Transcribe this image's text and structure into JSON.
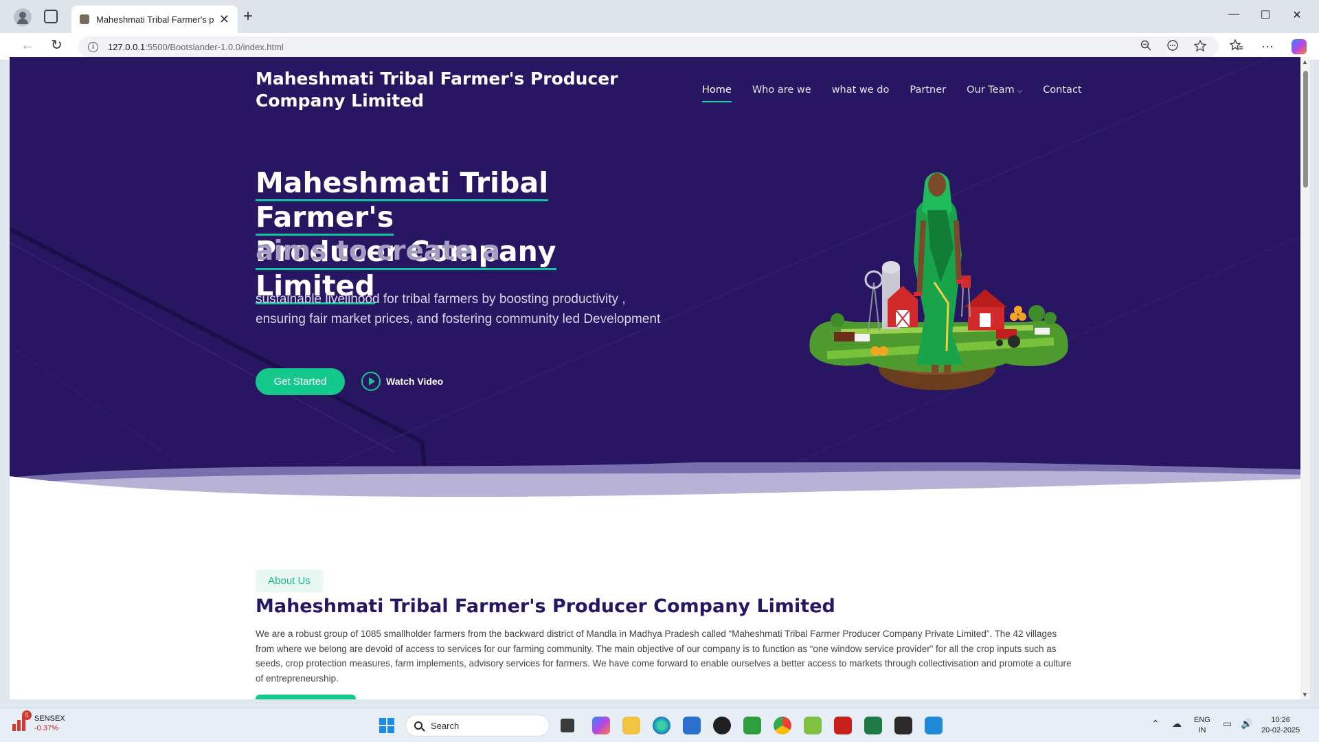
{
  "browser": {
    "tab_title": "Maheshmati Tribal Farmer's produ",
    "url_host": "127.0.0.1",
    "url_path": ":5500/Bootslander-1.0.0/index.html",
    "new_tab_symbol": "+",
    "tab_close_symbol": "✕",
    "minimize_symbol": "—",
    "maximize_symbol": "☐",
    "close_symbol": "✕",
    "back_symbol": "←",
    "reload_symbol": "↻",
    "more_symbol": "···"
  },
  "site": {
    "brand": "Maheshmati Tribal Farmer's Producer Company Limited",
    "nav": {
      "home": "Home",
      "who": "Who are we",
      "what": "what we do",
      "partner": "Partner",
      "team": "Our Team",
      "team_caret": "⌵",
      "contact": "Contact"
    },
    "hero": {
      "title_line1": "Maheshmati Tribal Farmer's",
      "title_line2": "Producer Company Limited",
      "subtitle": "aims to create a",
      "description": "sustainable livelihood for tribal farmers by boosting productivity , ensuring fair market prices, and fostering community led Development",
      "cta_label": "Get Started",
      "video_label": "Watch Video"
    },
    "about": {
      "badge": "About Us",
      "title": "Maheshmati Tribal Farmer's Producer Company Limited",
      "text": "We are a robust group of 1085 smallholder farmers from the backward district of Mandla in Madhya Pradesh called “Maheshmati Tribal Farmer Producer Company Private Limited”. The 42 villages from where we belong are devoid of access to services for our farming community. The main objective of our company is to function as “one window service provider” for all the crop inputs such as seeds, crop protection measures, farm implements, advisory services for farmers. We have come forward to enable ourselves a better access to markets through collectivisation and promote a culture of entrepreneurship."
    }
  },
  "taskbar": {
    "stock_name": "SENSEX",
    "stock_change": "-0.37%",
    "stock_badge": "5",
    "search_label": "Search",
    "lang_line1": "ENG",
    "lang_line2": "IN",
    "time": "10:26",
    "date": "20-02-2025"
  },
  "colors": {
    "hero_bg": "#281663",
    "accent": "#15c98c",
    "about_title": "#281663"
  }
}
